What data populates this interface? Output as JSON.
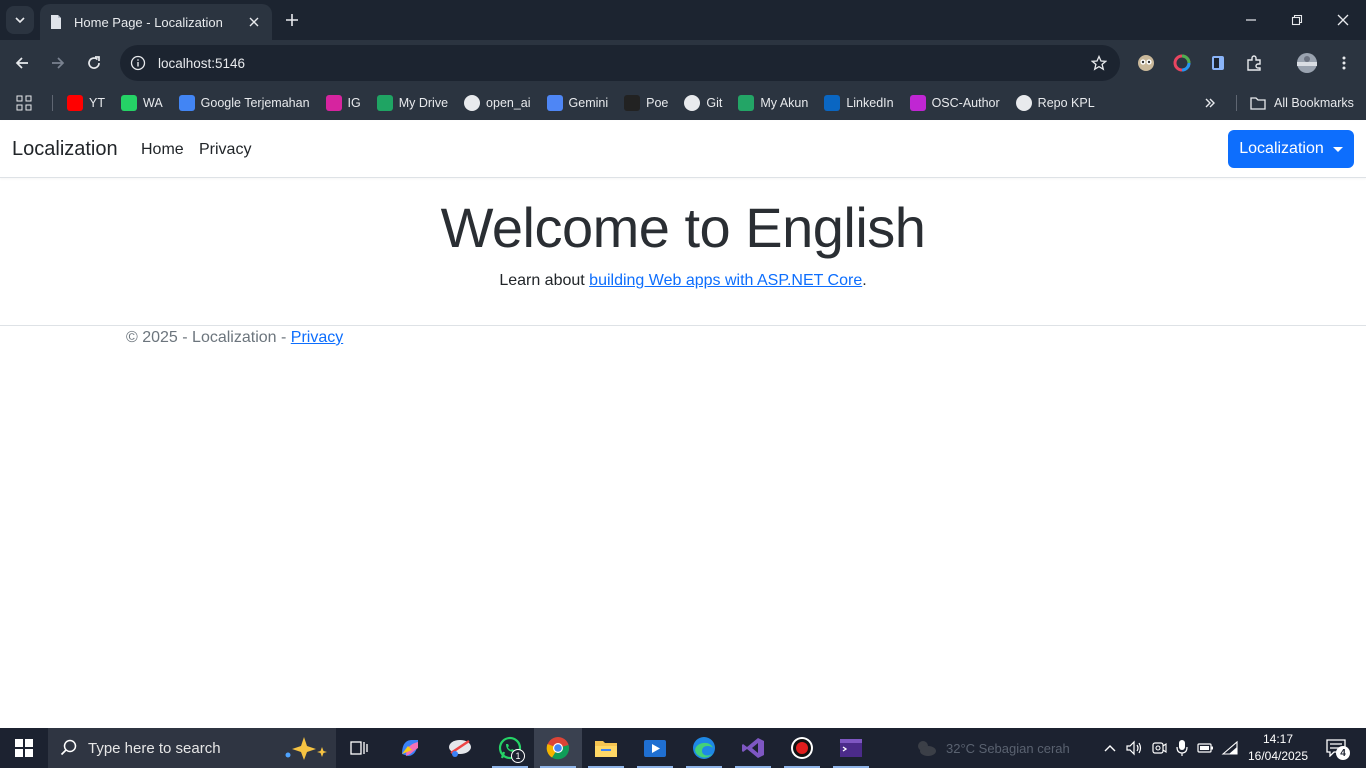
{
  "browser": {
    "tab_title": "Home Page - Localization",
    "url": "localhost:5146",
    "bookmarks": [
      {
        "label": "YT",
        "icon": "youtube-icon",
        "color": "#ff0000"
      },
      {
        "label": "WA",
        "icon": "whatsapp-icon",
        "color": "#25d366"
      },
      {
        "label": "Google Terjemahan",
        "icon": "google-translate-icon",
        "color": "#4285f4"
      },
      {
        "label": "IG",
        "icon": "instagram-icon",
        "color": "#d6249f"
      },
      {
        "label": "My Drive",
        "icon": "google-drive-icon",
        "color": "#1fa463"
      },
      {
        "label": "open_ai",
        "icon": "openai-icon",
        "color": "#e8eaed"
      },
      {
        "label": "Gemini",
        "icon": "gemini-icon",
        "color": "#4e86f5"
      },
      {
        "label": "Poe",
        "icon": "poe-icon",
        "color": "#222222"
      },
      {
        "label": "Git",
        "icon": "github-icon",
        "color": "#e8eaed"
      },
      {
        "label": "My Akun",
        "icon": "sheets-icon",
        "color": "#23a566"
      },
      {
        "label": "LinkedIn",
        "icon": "linkedin-icon",
        "color": "#0a66c2"
      },
      {
        "label": "OSC-Author",
        "icon": "osc-icon",
        "color": "#c026d3"
      },
      {
        "label": "Repo KPL",
        "icon": "github-icon",
        "color": "#e8eaed"
      }
    ],
    "all_bookmarks": "All Bookmarks"
  },
  "navbar": {
    "brand": "Localization",
    "links": [
      "Home",
      "Privacy"
    ],
    "dropdown_label": "Localization"
  },
  "hero": {
    "title": "Welcome to English",
    "sub_prefix": "Learn about ",
    "sub_link": "building Web apps with ASP.NET Core",
    "sub_suffix": "."
  },
  "footer": {
    "text": "© 2025 - Localization - ",
    "link": "Privacy"
  },
  "taskbar": {
    "search_placeholder": "Type here to search",
    "whatsapp_badge": "1",
    "weather": "32°C  Sebagian cerah",
    "time": "14:17",
    "date": "16/04/2025",
    "notification_count": "4"
  },
  "colors": {
    "primary": "#0d6efd",
    "chrome_dark": "#1c2430",
    "chrome_mid": "#2b3440"
  }
}
